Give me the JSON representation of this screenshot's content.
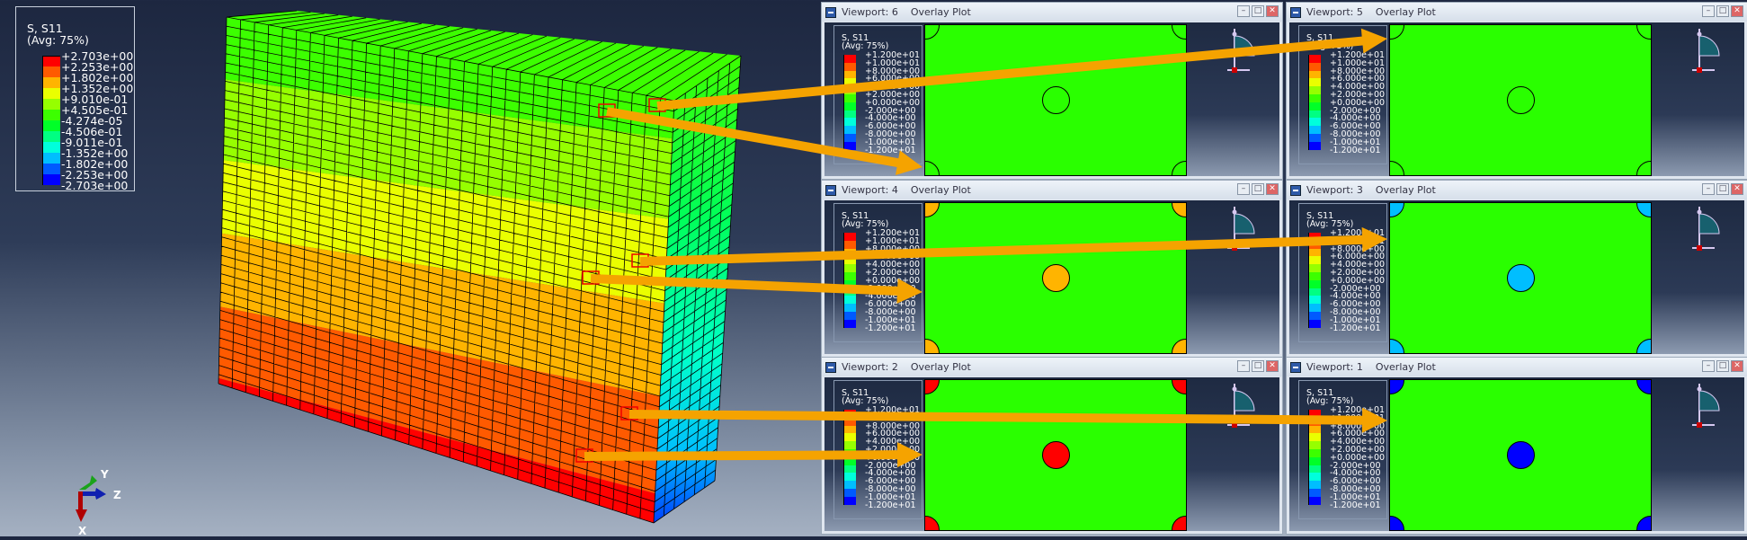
{
  "main_legend": {
    "title": "S, S11",
    "subtitle": "(Avg: 75%)",
    "labels": [
      "+2.703e+00",
      "+2.253e+00",
      "+1.802e+00",
      "+1.352e+00",
      "+9.010e-01",
      "+4.505e-01",
      "-4.274e-05",
      "-4.506e-01",
      "-9.011e-01",
      "-1.352e+00",
      "-1.802e+00",
      "-2.253e+00",
      "-2.703e+00"
    ],
    "colors": [
      "#ff0000",
      "#ff5a00",
      "#ffb400",
      "#eaff00",
      "#96ff00",
      "#3cff00",
      "#00ff28",
      "#00ff82",
      "#00ffdc",
      "#00beff",
      "#005aff",
      "#0000ff"
    ]
  },
  "triad": {
    "x": "X",
    "y": "Y",
    "z": "Z"
  },
  "viewport_legend": {
    "title": "S, S11",
    "subtitle": "(Avg: 75%)",
    "labels": [
      "+1.200e+01",
      "+1.000e+01",
      "+8.000e+00",
      "+6.000e+00",
      "+4.000e+00",
      "+2.000e+00",
      "+0.000e+00",
      "-2.000e+00",
      "-4.000e+00",
      "-6.000e+00",
      "-8.000e+00",
      "-1.000e+01",
      "-1.200e+01"
    ]
  },
  "viewports": [
    {
      "label": "Viewport: 6",
      "mode": "Overlay Plot",
      "hole_color": "#2aff00"
    },
    {
      "label": "Viewport: 5",
      "mode": "Overlay Plot",
      "hole_color": "#2aff00"
    },
    {
      "label": "Viewport: 4",
      "mode": "Overlay Plot",
      "hole_color": "#ffb400"
    },
    {
      "label": "Viewport: 3",
      "mode": "Overlay Plot",
      "hole_color": "#00beff"
    },
    {
      "label": "Viewport: 2",
      "mode": "Overlay Plot",
      "hole_color": "#ff0000"
    },
    {
      "label": "Viewport: 1",
      "mode": "Overlay Plot",
      "hole_color": "#0000ff"
    }
  ],
  "accent": "#f5a300"
}
